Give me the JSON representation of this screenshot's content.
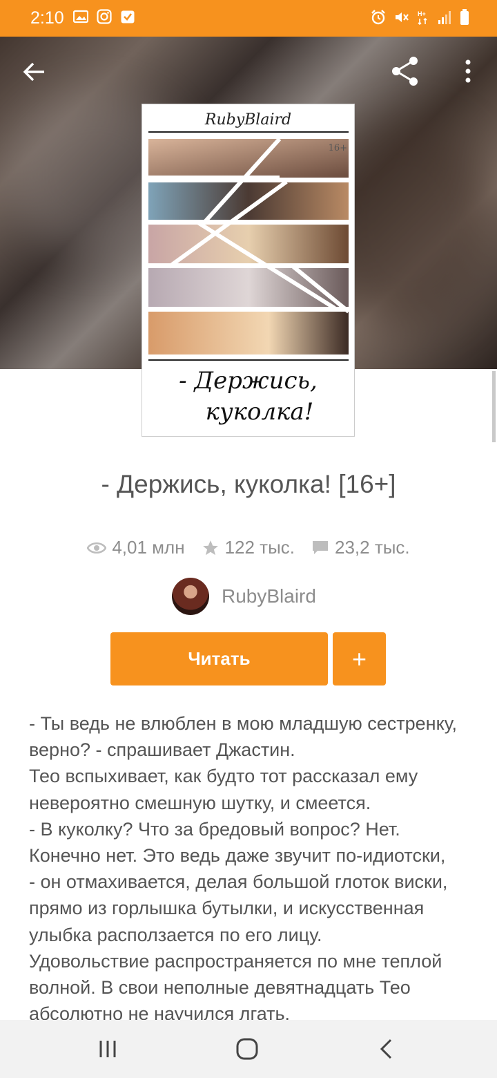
{
  "status_bar": {
    "time": "2:10",
    "color": "#f7921e",
    "left_icons": [
      "gallery-icon",
      "instagram-icon",
      "task-check-icon"
    ],
    "right_icons": [
      "alarm-icon",
      "mute-icon",
      "data-hd-icon",
      "signal-icon",
      "battery-icon"
    ]
  },
  "toolbar": {
    "back_icon": "arrow-left-icon",
    "share_icon": "share-icon",
    "more_icon": "more-vertical-icon"
  },
  "cover": {
    "author_script": "RubyBlaird",
    "age_mark": "16+",
    "title_line1": "- Держись,",
    "title_line2": "куколка!"
  },
  "story": {
    "title": "- Держись, куколка! [16+]",
    "stats": {
      "reads": "4,01 млн",
      "votes": "122 тыс.",
      "comments": "23,2 тыс."
    },
    "author": "RubyBlaird",
    "read_button": "Читать",
    "add_button": "+",
    "description_lines": [
      "- Ты ведь не влюблен в мою младшую сестренку,",
      "верно? - спрашивает Джастин.",
      "Тео вспыхивает, как будто тот рассказал ему",
      "невероятно смешную шутку, и смеется.",
      "- В куколку? Что за бредовый вопрос? Нет.",
      "Конечно нет. Это ведь даже звучит по-идиотски,",
      "- он отмахивается, делая большой глоток виски,",
      "прямо из горлышка бутылки, и искусственная",
      "улыбка расползается по его лицу.",
      "Удовольствие распространяется по мне теплой",
      "волной. В свои неполные девятнадцать Тео",
      "абсолютно не научился лгать."
    ]
  },
  "nav_bar": {
    "recents_icon": "recents-icon",
    "home_icon": "home-icon",
    "back_icon": "back-chevron-icon"
  }
}
